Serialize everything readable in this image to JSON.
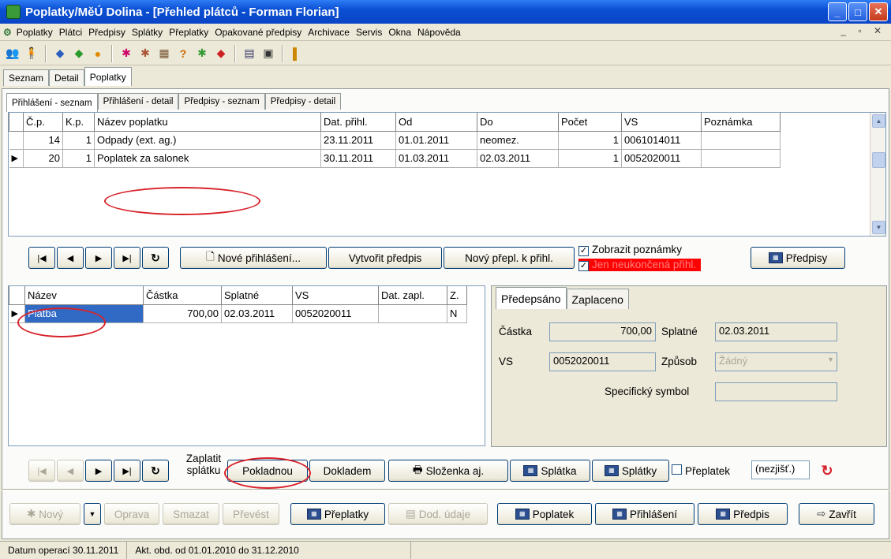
{
  "window": {
    "title": "Poplatky/MěÚ Dolina - [Přehled plátců - Forman Florian]"
  },
  "menu": [
    "Poplatky",
    "Plátci",
    "Předpisy",
    "Splátky",
    "Přeplatky",
    "Opakované předpisy",
    "Archivace",
    "Servis",
    "Okna",
    "Nápověda"
  ],
  "tabs_main": [
    "Seznam",
    "Detail",
    "Poplatky"
  ],
  "tabs_sub": [
    "Přihlášení - seznam",
    "Přihlášení - detail",
    "Předpisy - seznam",
    "Předpisy - detail"
  ],
  "reg_grid": {
    "headers": [
      "Č.p.",
      "K.p.",
      "Název poplatku",
      "Dat. přihl.",
      "Od",
      "Do",
      "Počet",
      "VS",
      "Poznámka"
    ],
    "rows": [
      [
        "14",
        "1",
        "Odpady (ext. ag.)",
        "23.11.2011",
        "01.01.2011",
        "neomez.",
        "1",
        "0061014011",
        ""
      ],
      [
        "20",
        "1",
        "Poplatek za salonek",
        "30.11.2011",
        "01.03.2011",
        "02.03.2011",
        "1",
        "0052020011",
        ""
      ]
    ]
  },
  "reg_buttons": {
    "new": "Nové přihlášení...",
    "create": "Vytvořit předpis",
    "overpay": "Nový přepl. k přihl.",
    "show_notes": "Zobrazit poznámky",
    "only_open": "Jen neukončená přihl.",
    "predpisy": "Předpisy"
  },
  "pay_grid": {
    "headers": [
      "Název",
      "Částka",
      "Splatné",
      "VS",
      "Dat. zapl.",
      "Z."
    ],
    "rows": [
      [
        "Platba",
        "700,00",
        "02.03.2011",
        "0052020011",
        "",
        "N"
      ]
    ]
  },
  "detail": {
    "tabs": [
      "Předepsáno",
      "Zaplaceno"
    ],
    "castka_label": "Částka",
    "castka": "700,00",
    "splatne_label": "Splatné",
    "splatne": "02.03.2011",
    "vs_label": "VS",
    "vs": "0052020011",
    "zpusob_label": "Způsob",
    "zpusob": "Žádný",
    "spec_label": "Specifický symbol",
    "spec": ""
  },
  "pay_buttons": {
    "zaplatit": "Zaplatit splátku",
    "pokladnou": "Pokladnou",
    "dokladem": "Dokladem",
    "slozenka": "Složenka aj.",
    "splatka": "Splátka",
    "splatky": "Splátky",
    "preplatek": "Přeplatek",
    "nezjist": "(nezjišť.)"
  },
  "bottom": {
    "novy": "Nový",
    "oprava": "Oprava",
    "smazat": "Smazat",
    "prevest": "Převést",
    "preplatky": "Přeplatky",
    "dod": "Dod. údaje",
    "poplatek": "Poplatek",
    "prihlaseni": "Přihlášení",
    "predpis": "Předpis",
    "zavrit": "Zavřít"
  },
  "status": {
    "date": "Datum operací 30.11.2011",
    "period": "Akt. obd. od 01.01.2010 do 31.12.2010"
  },
  "colors": {
    "title": "#0a4fd4",
    "highlight": "#d8222a",
    "selected": "#316ac5"
  }
}
